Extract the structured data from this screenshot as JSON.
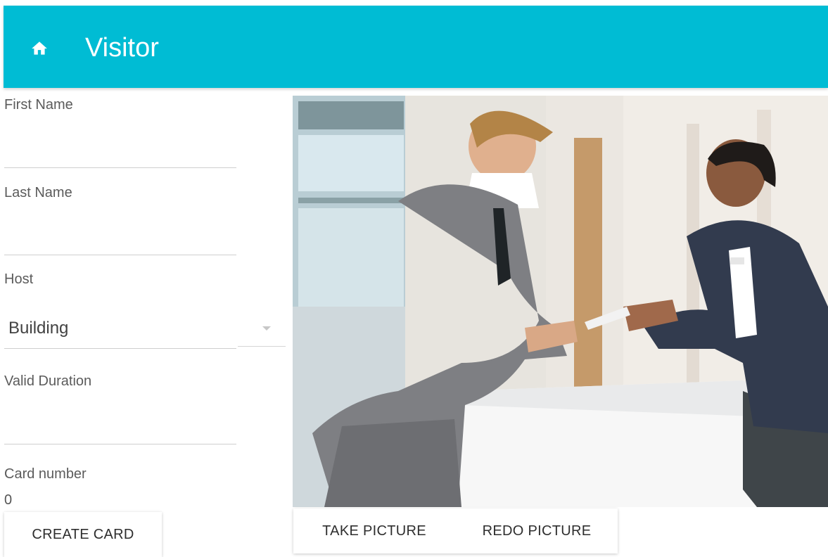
{
  "appbar": {
    "title": "Visitor",
    "icon": "home-icon",
    "color": "#00bcd4"
  },
  "form": {
    "first_name": {
      "label": "First Name",
      "value": ""
    },
    "last_name": {
      "label": "Last Name",
      "value": ""
    },
    "host": {
      "label": "Host",
      "selected": "Building"
    },
    "valid_duration": {
      "label": "Valid Duration",
      "value": ""
    },
    "card_number": {
      "label": "Card number",
      "value": "0"
    }
  },
  "buttons": {
    "create_card": "CREATE CARD",
    "take_picture": "TAKE PICTURE",
    "redo_picture": "REDO PICTURE"
  },
  "photo": {
    "description_icon": "visitor-photo"
  }
}
